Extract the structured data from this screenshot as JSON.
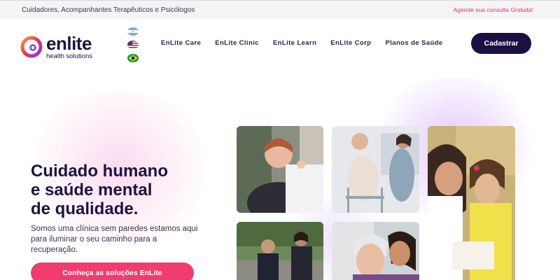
{
  "topbar": {
    "tagline": "Cuidadores, Acompanhantes Terapêuticos e Psicólogos",
    "schedule_link": "Agende sua consulta Gratuita!"
  },
  "brand": {
    "name": "enlite",
    "subtitle": "health solutions"
  },
  "languages": [
    "argentina-flag-icon",
    "usa-flag-icon",
    "brazil-flag-icon"
  ],
  "nav": {
    "items": [
      {
        "label": "EnLite Care"
      },
      {
        "label": "EnLite Clinic"
      },
      {
        "label": "EnLite Learn"
      },
      {
        "label": "EnLite Corp"
      },
      {
        "label": "Planos de Saúde"
      }
    ],
    "register_label": "Cadastrar"
  },
  "hero": {
    "line1": "Cuidado humano",
    "line2": "e saúde mental",
    "line3": "de qualidade.",
    "description": "Somos uma clínica sem paredes estamos aqui para iluminar o seu caminho para a recuperação.",
    "cta_label": "Conheça as soluções EnLite"
  },
  "photos": [
    "caregiver-feeding-elderly-woman",
    "caregiver-helping-elderly-man-walker",
    "mother-reading-with-daughter",
    "caregiver-with-man-outdoors",
    "caregiver-hugging-elderly-woman"
  ],
  "colors": {
    "navy": "#1c0f43",
    "pink": "#f03c6e",
    "topbar_link": "#e8315b"
  }
}
